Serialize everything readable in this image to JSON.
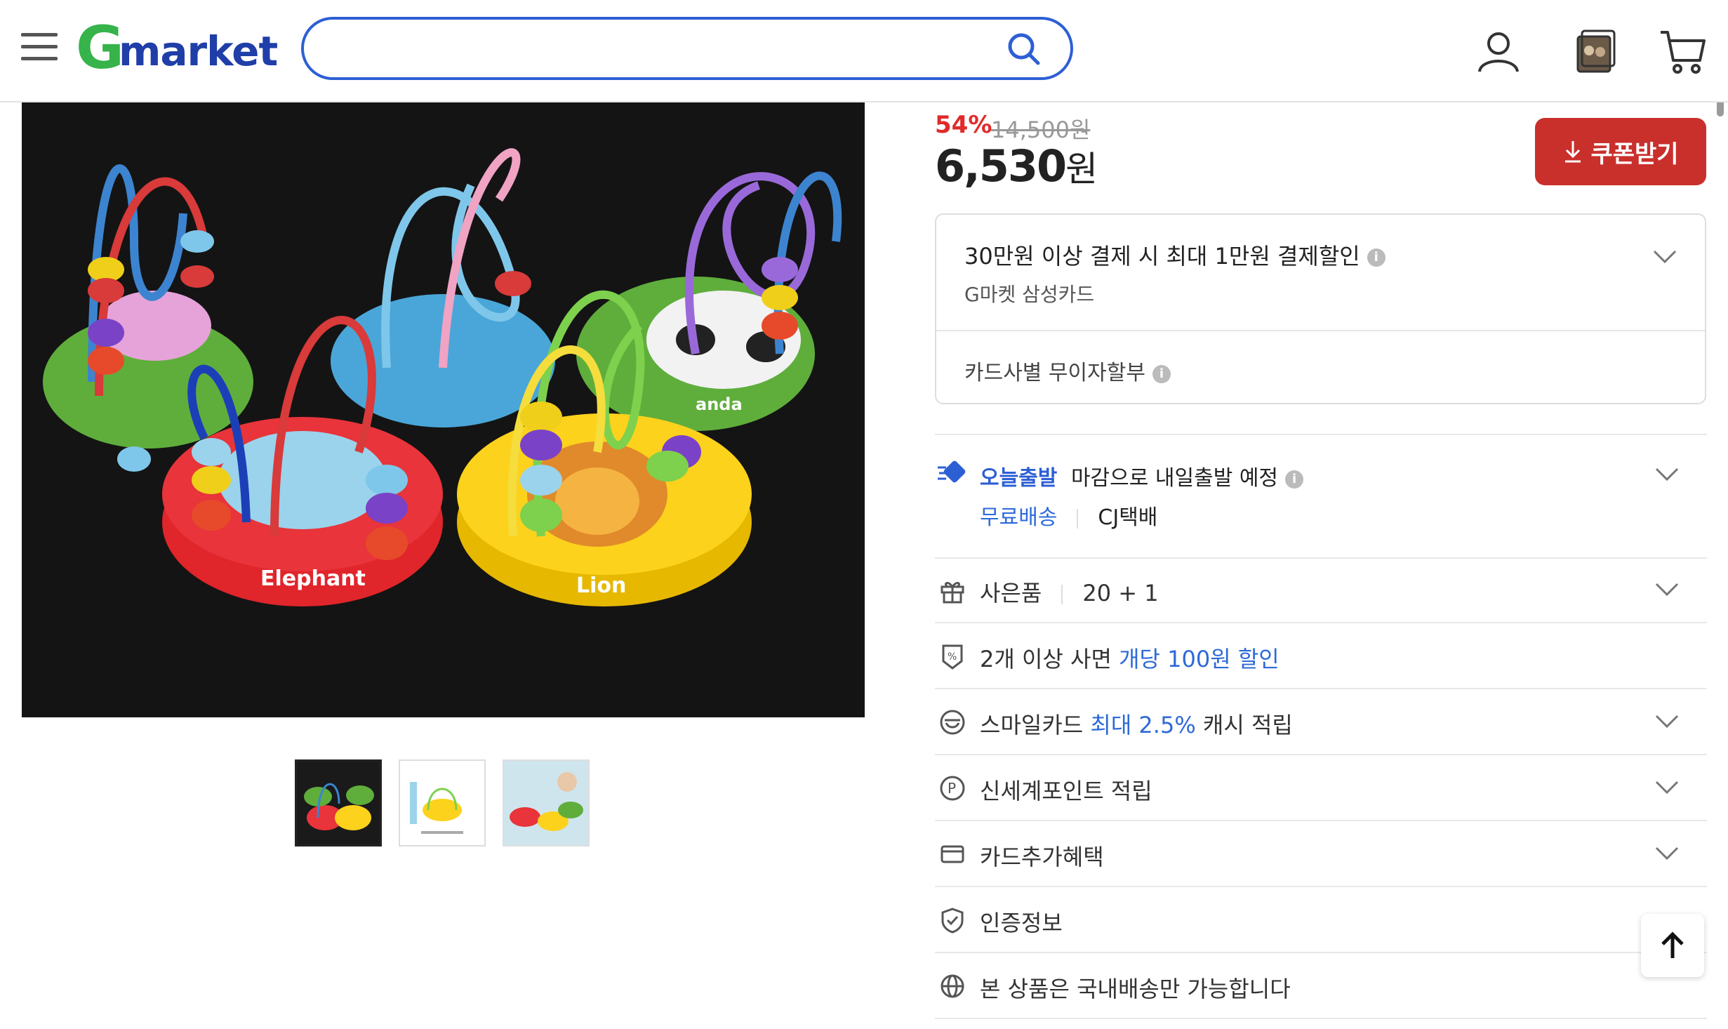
{
  "header": {
    "logo_g": "G",
    "logo_rest": "market",
    "search_placeholder": "",
    "icons": [
      "menu-icon",
      "search-icon",
      "user-icon",
      "recent-items-icon",
      "cart-icon"
    ],
    "brand_green": "#36b34a",
    "brand_blue": "#1f3ea8"
  },
  "product": {
    "image_labels": [
      "Elephant",
      "Lion",
      "anda"
    ],
    "thumbnails": [
      "thumbnail-1",
      "thumbnail-2",
      "thumbnail-3"
    ]
  },
  "price": {
    "discount": "54%",
    "original": "14,500원",
    "sale_number": "6,530",
    "sale_unit": "원",
    "coupon_button": "쿠폰받기"
  },
  "card_benefit": {
    "title": "30만원 이상 결제 시 최대 1만원 결제할인",
    "card_name": "G마켓 삼성카드",
    "installment": "카드사별 무이자할부"
  },
  "shipping": {
    "badge": "오늘출발",
    "text": "마감으로 내일출발 예정",
    "free": "무료배송",
    "courier": "CJ택배"
  },
  "rows": {
    "gift_label": "사은품",
    "gift_value": "20 + 1",
    "multi_prefix": "2개 이상 사면",
    "multi_highlight": "개당 100원 할인",
    "smile_prefix": "스마일카드",
    "smile_highlight": "최대 2.5%",
    "smile_suffix": "캐시 적립",
    "shinsegae": "신세계포인트 적립",
    "card_extra": "카드추가혜택",
    "certification": "인증정보",
    "domestic": "본 상품은 국내배송만 가능합니다"
  },
  "colors": {
    "accent_red": "#c9302c",
    "link_blue": "#2d6ad8"
  }
}
